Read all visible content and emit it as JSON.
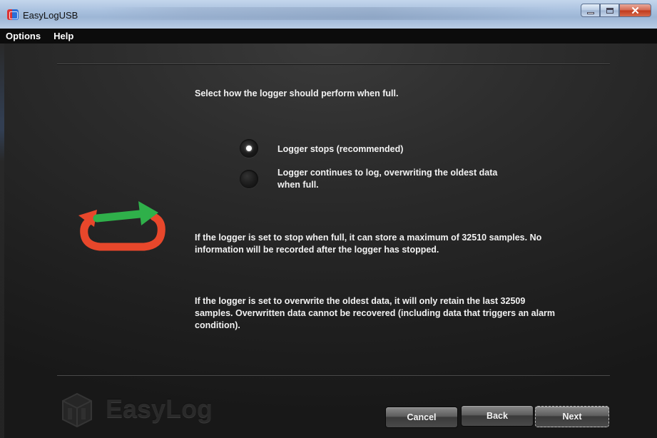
{
  "window": {
    "title": "EasyLogUSB"
  },
  "menu": {
    "items": [
      "Options",
      "Help"
    ]
  },
  "wizard": {
    "heading": "Select how the logger should perform when full.",
    "options": [
      {
        "label": "Logger stops (recommended)",
        "selected": true
      },
      {
        "label": "Logger continues to log, overwriting the oldest data when full.",
        "selected": false
      }
    ],
    "info_stop": "If the logger is set to stop when full, it can store a maximum of 32510 samples. No information will be recorded after the logger has stopped.",
    "info_overwrite": "If the logger is set to overwrite the oldest data, it will only retain the last 32509 samples. Overwritten data cannot be recovered (including data that triggers an alarm condition).",
    "icon": "cycle-arrows-icon"
  },
  "branding": {
    "logo_text": "EasyLog"
  },
  "buttons": {
    "cancel": "Cancel",
    "back": "Back",
    "next": "Next"
  },
  "colors": {
    "arrow_green": "#2fb04a",
    "arrow_red": "#e8472b",
    "background": "#2c2c2c"
  }
}
